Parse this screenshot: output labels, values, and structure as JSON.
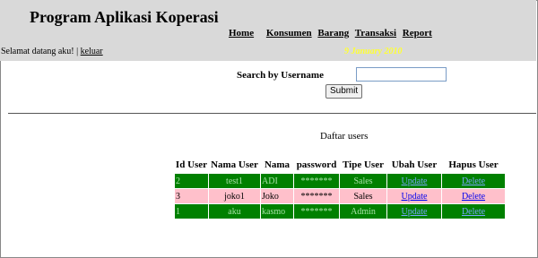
{
  "header": {
    "title": "Program Aplikasi Koperasi",
    "nav": [
      "Home",
      "Konsumen",
      "Barang",
      "Transaksi",
      "Report"
    ],
    "welcome_text": "Selamat datang aku! | ",
    "logout_label": "keluar",
    "date": "9 January 2010"
  },
  "search": {
    "label": "Search by Username",
    "value": "",
    "submit_label": "Submit"
  },
  "table": {
    "title": "Daftar users",
    "headers": [
      "Id User",
      "Nama User",
      "Nama",
      "password",
      "Tipe User",
      "Ubah User",
      "Hapus User"
    ],
    "rows": [
      {
        "id": "2",
        "username": "test1",
        "nama": "ADI",
        "password": "*******",
        "tipe": "Sales",
        "ubah": "Update",
        "hapus": "Delete"
      },
      {
        "id": "3",
        "username": "joko1",
        "nama": "Joko",
        "password": "*******",
        "tipe": "Sales",
        "ubah": "Update",
        "hapus": "Delete"
      },
      {
        "id": "1",
        "username": "aku",
        "nama": "kasmo",
        "password": "*******",
        "tipe": "Admin",
        "ubah": "Update",
        "hapus": "Delete"
      }
    ],
    "row_colors": {
      "green": "#008000",
      "pink": "#ffc0cb"
    }
  },
  "colors": {
    "header_bg": "#d9d9d9",
    "date": "#ffff33"
  }
}
